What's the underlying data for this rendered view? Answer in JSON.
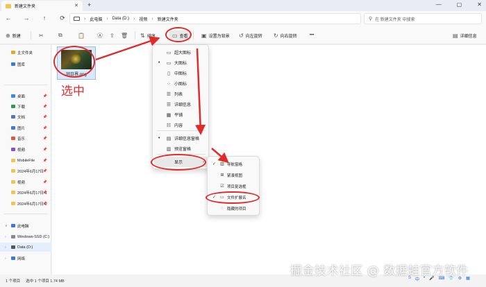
{
  "window": {
    "tab_title": "新建文件夹",
    "tab_close": "✕",
    "tab_add": "+",
    "controls": [
      "—",
      "▢",
      "✕"
    ]
  },
  "nav": {
    "back": "←",
    "forward": "→",
    "up": "↑",
    "refresh": "⟳"
  },
  "breadcrumb": [
    "此电脑",
    "Data (D:)",
    "视频",
    "新建文件夹"
  ],
  "breadcrumb_sep": "›",
  "search": {
    "icon": "⚲",
    "placeholder": "在 新建文件夹 中搜索"
  },
  "toolbar": {
    "new_label": "新建",
    "new_icon": "⊕",
    "cut_icon": "✂",
    "copy_icon": "⧉",
    "paste_icon": "📋",
    "rename_icon": "Ⓐ",
    "share_icon": "⇪",
    "delete_icon": "🗑",
    "sort_label": "排序",
    "sort_icon": "⇅",
    "view_label": "查看",
    "view_icon": "▭",
    "set_bg_label": "设置为背景",
    "rotate_left_label": "向左旋转",
    "rotate_right_label": "向右旋转",
    "more_label": "•••",
    "details_label": "详细信息"
  },
  "sidebar": {
    "items": [
      {
        "label": "主文件夹",
        "color": "#e0a92b"
      },
      {
        "label": "图库",
        "color": "#3b78d8"
      },
      {
        "label": "桌面",
        "color": "#3b8be0"
      },
      {
        "label": "下载",
        "color": "#2c9a56"
      },
      {
        "label": "文档",
        "color": "#5577aa"
      },
      {
        "label": "图片",
        "color": "#3b78d8"
      },
      {
        "label": "音乐",
        "color": "#e0573b"
      },
      {
        "label": "视频",
        "color": "#8a4bd8"
      },
      {
        "label": "MobileFile",
        "color": "#f2c34d"
      },
      {
        "label": "2024年6月17日",
        "color": "#f2c34d"
      },
      {
        "label": "视频",
        "color": "#f2c34d"
      },
      {
        "label": "2024年6月17日-1",
        "color": "#f2c34d"
      },
      {
        "label": "2024年6月17日-2",
        "color": "#f2c34d"
      },
      {
        "label": "此电脑",
        "color": "#3b78d8"
      },
      {
        "label": "Windows-SSD (C:)",
        "color": "#888888"
      },
      {
        "label": "Data (D:)",
        "color": "#555555"
      },
      {
        "label": "网络",
        "color": "#3b78d8"
      }
    ],
    "pin": "📌"
  },
  "file": {
    "name": "同日界.png"
  },
  "status": {
    "count": "1 个项目",
    "selected": "选中 1 个项目  1.74 MB"
  },
  "view_menu": {
    "items": [
      {
        "label": "超大图标",
        "icon": "▭"
      },
      {
        "label": "大图标",
        "icon": "▭",
        "selected": true
      },
      {
        "label": "中图标",
        "icon": "▯"
      },
      {
        "label": "小图标",
        "icon": "⁘"
      },
      {
        "label": "列表",
        "icon": "☰"
      },
      {
        "label": "详细信息",
        "icon": "☰"
      },
      {
        "label": "平铺",
        "icon": "▦"
      },
      {
        "label": "内容",
        "icon": "☷"
      },
      {
        "label": "详细信息窗格",
        "icon": "▤",
        "selected": true
      },
      {
        "label": "预览窗格",
        "icon": "▥"
      },
      {
        "label": "显示",
        "icon": "",
        "submenu": "›"
      }
    ],
    "dot": "•"
  },
  "show_menu": {
    "items": [
      {
        "label": "导航窗格",
        "icon": "▥",
        "checked": true
      },
      {
        "label": "紧凑视图",
        "icon": "⊞"
      },
      {
        "label": "项目复选框",
        "icon": "☑"
      },
      {
        "label": "文件扩展名",
        "icon": "▭",
        "checked": true
      },
      {
        "label": "隐藏的项目",
        "icon": "◌"
      }
    ],
    "check": "✓"
  },
  "annotation": {
    "text": "选中",
    "color": "#e02b2b"
  },
  "watermark": "掘金技术社区 @ 数据蛙官方软件",
  "tray": [
    "S",
    "中",
    "•",
    "🎤",
    "⌨",
    "👕",
    "⚙",
    "▦"
  ]
}
